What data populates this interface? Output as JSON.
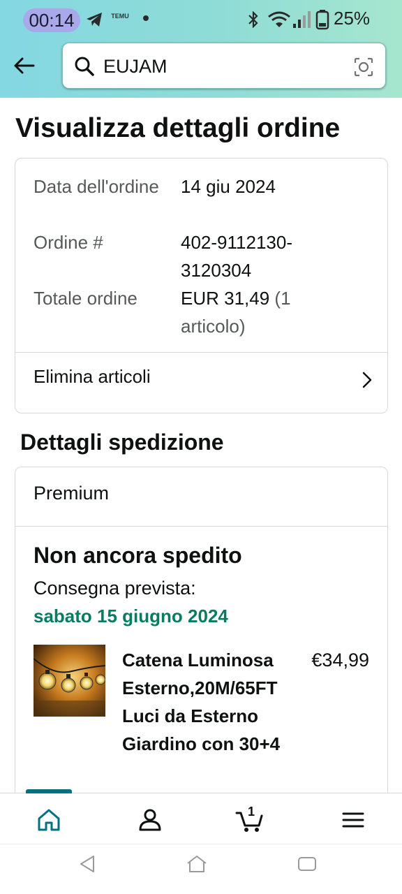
{
  "status_bar": {
    "time": "00:14",
    "temu_label": "TEMU",
    "battery": "25%"
  },
  "search": {
    "value": "EUJAM"
  },
  "page": {
    "title": "Visualizza dettagli ordine"
  },
  "order_summary": {
    "date_label": "Data dell'ordine",
    "date_value": "14 giu 2024",
    "order_label": "Ordine #",
    "order_value": "402-9112130-3120304",
    "total_label": "Totale ordine",
    "total_value": "EUR 31,49",
    "total_count": "(1 articolo)",
    "delete_items": "Elimina articoli"
  },
  "shipping": {
    "section_title": "Dettagli spedizione",
    "type": "Premium",
    "status": "Non ancora spedito",
    "delivery_label": "Consegna prevista:",
    "delivery_date": "sabato 15 giugno 2024",
    "product": {
      "name": "Catena Luminosa Esterno,20M/65FT Luci da Esterno Giardino con 30+4",
      "price": "€34,99"
    }
  },
  "bottom_nav": {
    "items": [
      "home-icon",
      "account-icon",
      "cart-icon",
      "menu-icon"
    ],
    "cart_count": "1"
  },
  "colors": {
    "accent": "#007185",
    "green": "#067d62",
    "header_start": "#84d8e2",
    "header_end": "#a6e6cf"
  }
}
